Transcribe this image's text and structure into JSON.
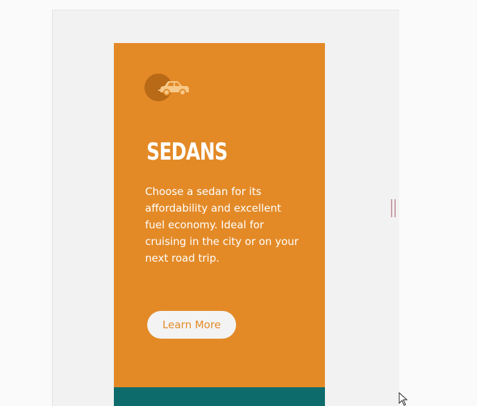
{
  "card": {
    "icon": "car-icon",
    "title": "SEDANS",
    "description": "Choose a sedan for its affordability and excellent fuel economy. Ideal for cruising in the city or on your next road trip.",
    "button_label": "Learn More"
  },
  "colors": {
    "page_background": "#fafafa",
    "panel_background": "#f2f2f2",
    "card_background": "#e38a27",
    "icon_circle": "#b96a17",
    "icon_fill": "#f7c98a",
    "button_background": "#f3f3f3",
    "button_text": "#e38a27",
    "footer_band": "#0e6b6b"
  }
}
